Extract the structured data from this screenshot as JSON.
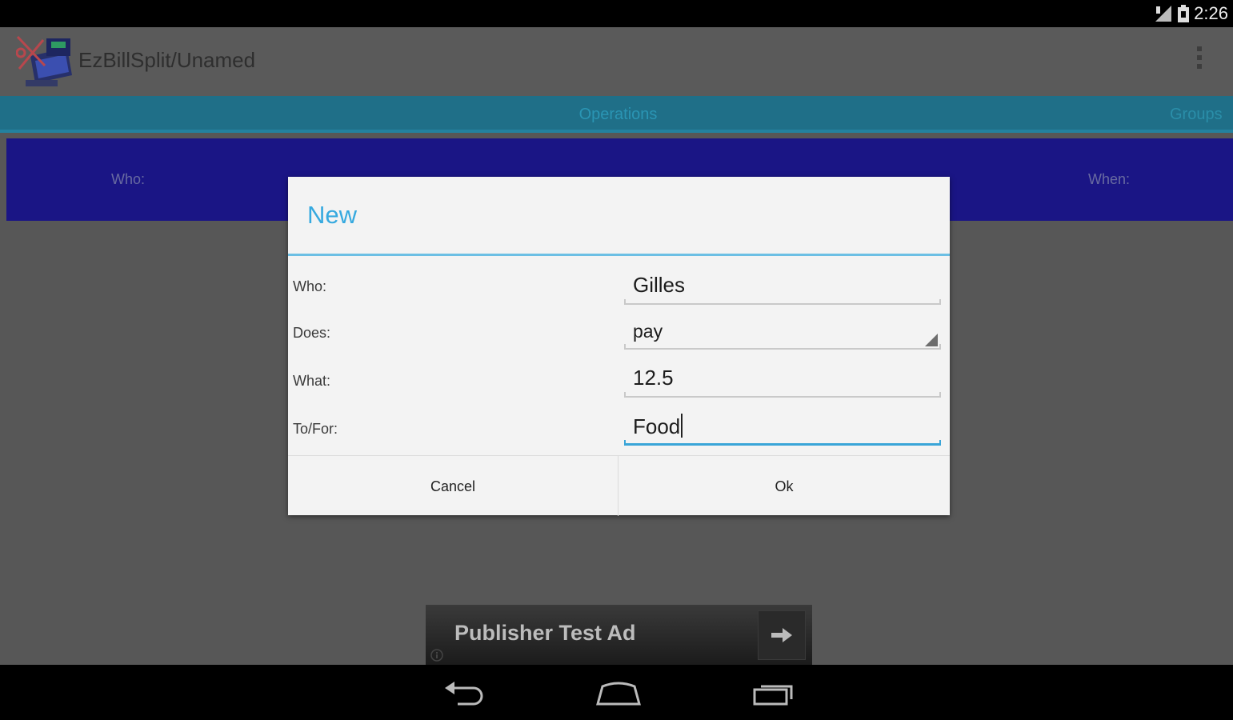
{
  "status_bar": {
    "time": "2:26",
    "icons": [
      "signal-icon",
      "battery-icon"
    ]
  },
  "app": {
    "title": "EzBillSplit/Unamed",
    "icon": "cash-register-icon"
  },
  "tabs": [
    {
      "label": "Operations",
      "selected": true
    },
    {
      "label": "Groups",
      "selected": false
    }
  ],
  "table_header": {
    "who": "Who:",
    "when": "When:"
  },
  "dialog": {
    "title": "New",
    "fields": {
      "who": {
        "label": "Who:",
        "value": "Gilles"
      },
      "does": {
        "label": "Does:",
        "value": "pay"
      },
      "what": {
        "label": "What:",
        "value": "12.5"
      },
      "to_for": {
        "label": "To/For:",
        "value": "Food"
      }
    },
    "buttons": {
      "cancel": "Cancel",
      "ok": "Ok"
    }
  },
  "ad": {
    "text": "Publisher Test Ad"
  },
  "colors": {
    "accent": "#36a9df",
    "header_row": "#1a1585",
    "tab_strip": "#1f6f88"
  }
}
